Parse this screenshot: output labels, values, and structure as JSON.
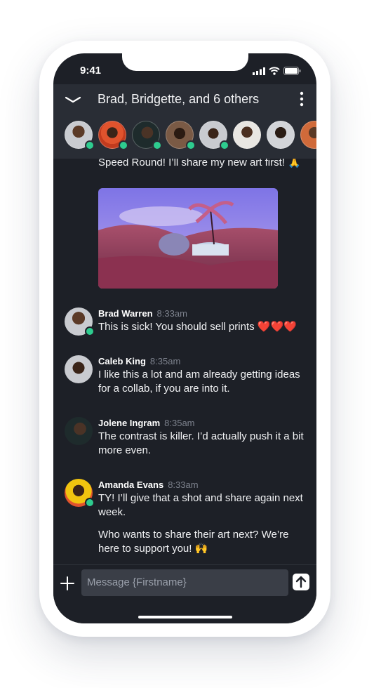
{
  "status": {
    "time": "9:41"
  },
  "header": {
    "title": "Brad, Bridgette, and 6 others"
  },
  "participants": [
    {
      "name": "participant-1",
      "online": true
    },
    {
      "name": "participant-2",
      "online": true
    },
    {
      "name": "participant-3",
      "online": true
    },
    {
      "name": "participant-4",
      "online": true
    },
    {
      "name": "participant-5",
      "online": true
    },
    {
      "name": "participant-6",
      "online": false
    },
    {
      "name": "participant-7",
      "online": false
    },
    {
      "name": "participant-8",
      "online": false
    }
  ],
  "feed": {
    "continued_text": "Speed Round! I’ll share my new art first! 🙏",
    "messages": [
      {
        "author": "Brad Warren",
        "time": "8:33am",
        "lines": [
          "This is sick! You should sell prints ❤️❤️❤️"
        ]
      },
      {
        "author": "Caleb King",
        "time": "8:35am",
        "lines": [
          "I like this a lot and am already getting ideas for a collab, if you are into it."
        ]
      },
      {
        "author": "Jolene Ingram",
        "time": "8:35am",
        "lines": [
          "The contrast is killer. I’d actually push it a bit more even."
        ]
      },
      {
        "author": "Amanda Evans",
        "time": "8:33am",
        "lines": [
          "TY! I’ll give that a shot and share again next week.",
          "Who wants to share their art next? We’re here to support you! 🙌"
        ]
      }
    ]
  },
  "composer": {
    "placeholder": "Message {Firstname}"
  }
}
